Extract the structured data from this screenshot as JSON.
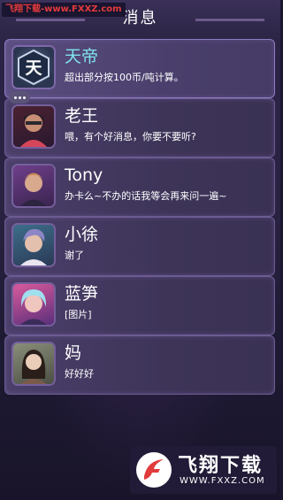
{
  "watermark": {
    "site": "飞翔下载",
    "url": "www.FXXZ.com",
    "brand": "飞翔下载",
    "brand_url": "WWW.FXXZ.COM"
  },
  "header": {
    "title": "消息"
  },
  "conversations": [
    {
      "name": "天帝",
      "message": "超出部分按100币/吨计算。",
      "avatar": "tiandi-emblem-avatar"
    },
    {
      "name": "老王",
      "message": "喂，有个好消息，你要不要听?",
      "avatar": "laowang-avatar",
      "typing": true
    },
    {
      "name": "Tony",
      "message": "办卡么~不办的话我等会再来问一遍~",
      "avatar": "tony-avatar"
    },
    {
      "name": "小徐",
      "message": "谢了",
      "avatar": "xiaoxu-avatar"
    },
    {
      "name": "蓝笋",
      "message": "[图片]",
      "avatar": "lansun-avatar"
    },
    {
      "name": "妈",
      "message": "好好好",
      "avatar": "mom-avatar"
    }
  ],
  "colors": {
    "accent_name": "#7fe3ee",
    "row_border": "#6c5c92",
    "watermark_red": "#e23b3b"
  }
}
